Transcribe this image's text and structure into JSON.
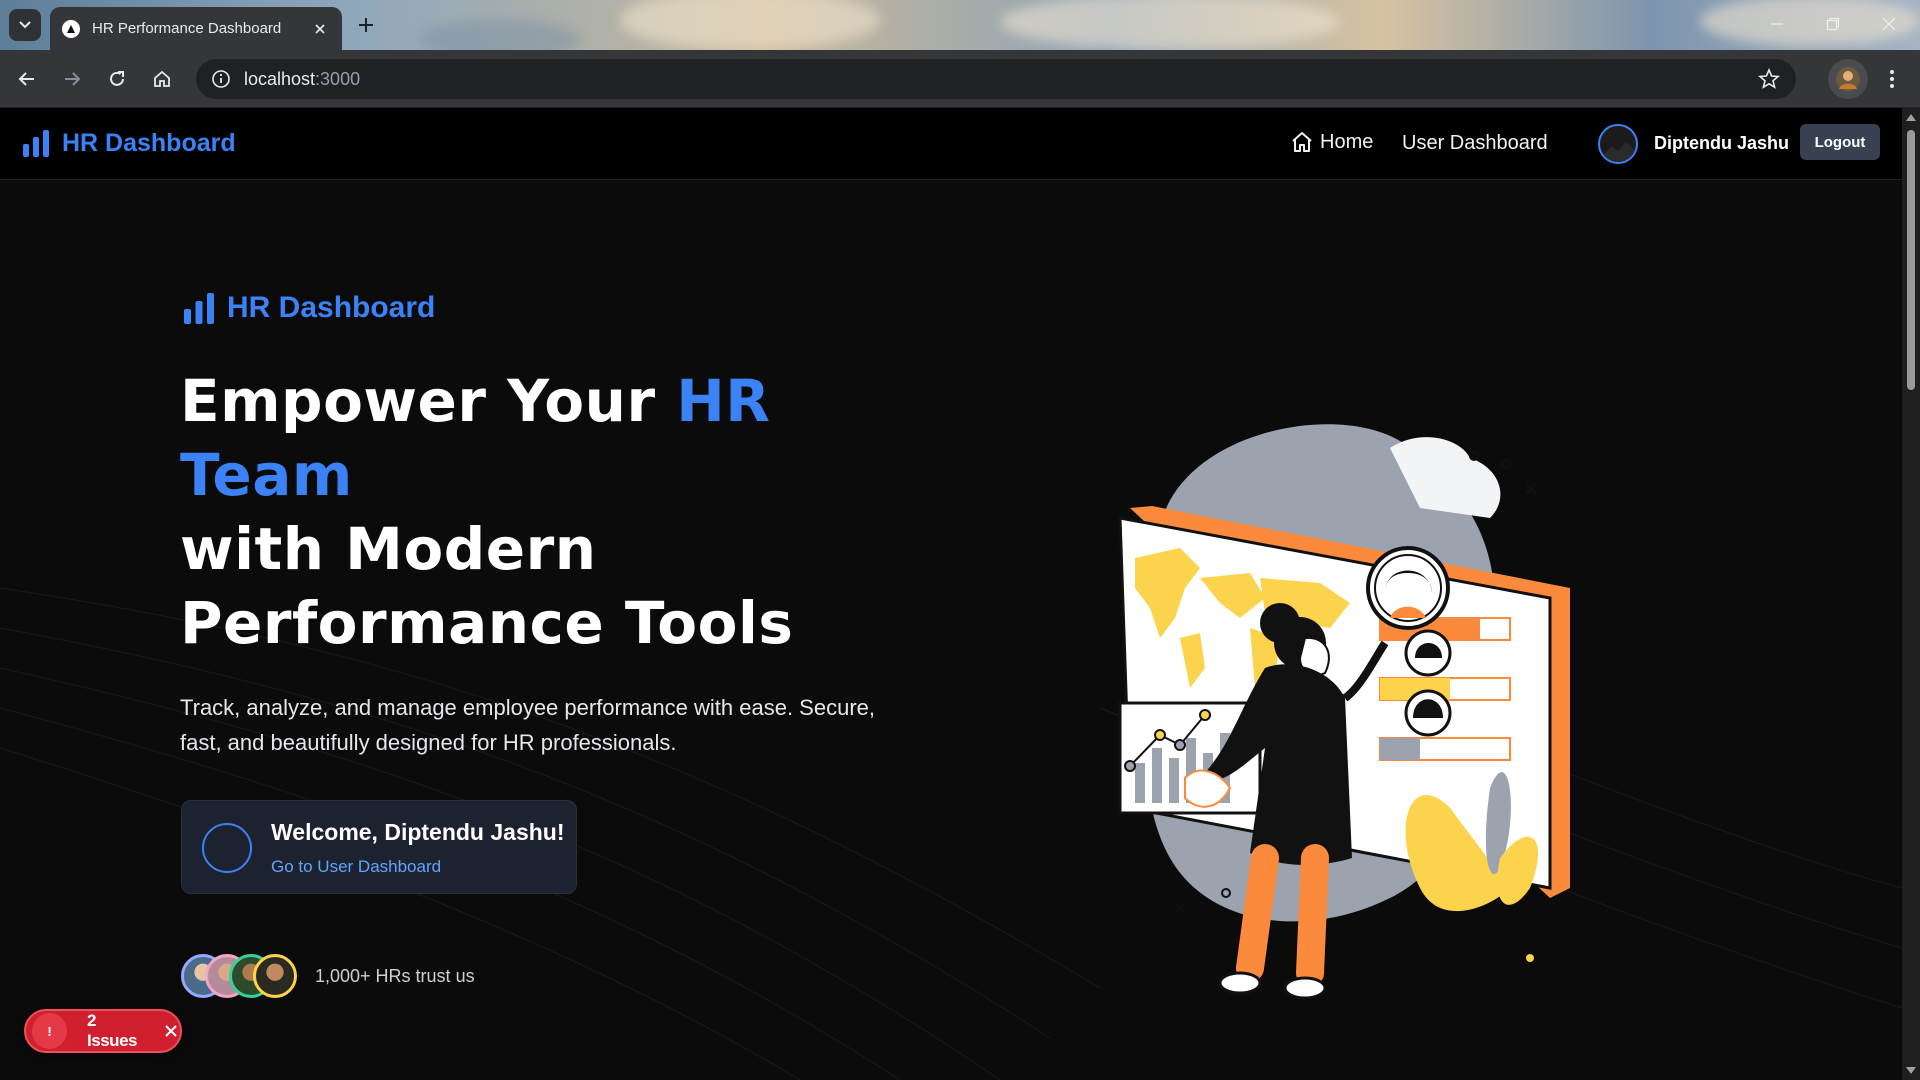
{
  "browser": {
    "tab_title": "HR Performance Dashboard",
    "url_host": "localhost",
    "url_port": ":3000"
  },
  "navbar": {
    "brand": "HR Dashboard",
    "home_label": "Home",
    "user_dashboard_label": "User Dashboard",
    "username": "Diptendu Jashu",
    "logout_label": "Logout"
  },
  "hero": {
    "badge": "HR Dashboard",
    "headline": {
      "part1": "Empower Your ",
      "accent": "HR Team",
      "part2": "with Modern Performance Tools"
    },
    "subtext": "Track, analyze, and manage employee performance with ease. Secure, fast, and beautifully designed for HR professionals.",
    "welcome_title": "Welcome, Diptendu Jashu!",
    "welcome_link": "Go to User Dashboard",
    "trust_text": "1,000+ HRs trust us"
  },
  "dev_overlay": {
    "issues_label": "2 Issues",
    "bang": "!"
  },
  "colors": {
    "accent": "#3b82f6",
    "issues": "#d01f2f",
    "illustration_orange": "#fb8a3c",
    "illustration_yellow": "#fcd34d"
  }
}
